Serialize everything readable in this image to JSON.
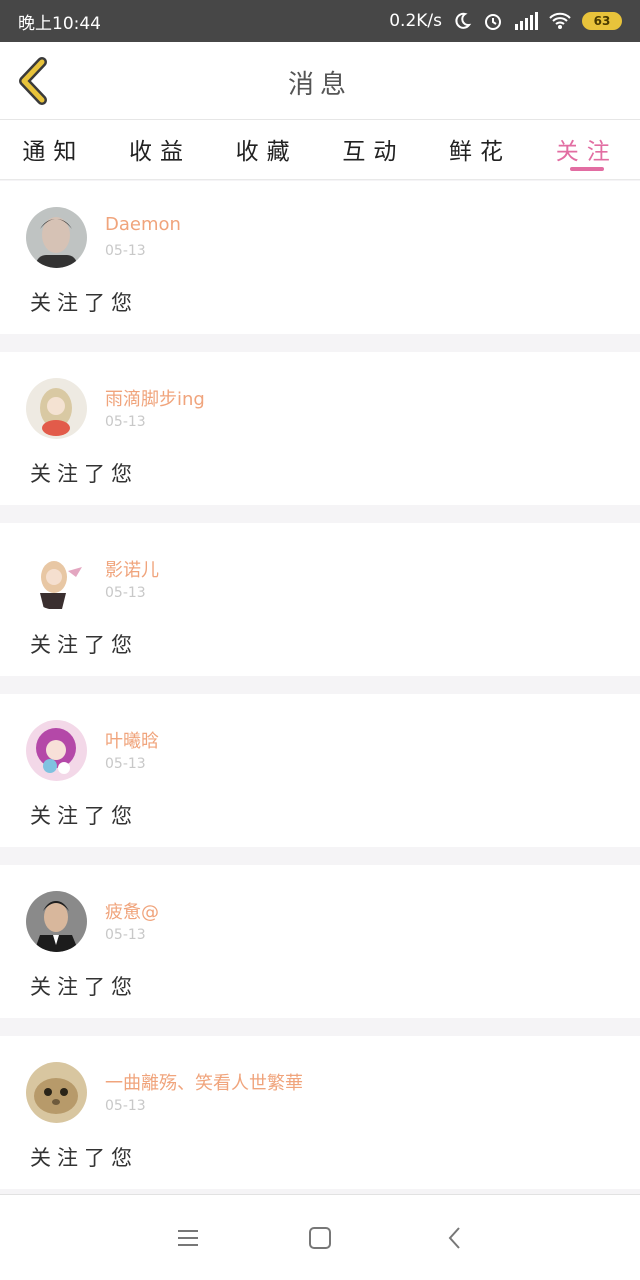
{
  "status_bar": {
    "time": "晚上10:44",
    "network_speed": "0.2K/s",
    "battery_level": "63",
    "icons": [
      "moon-icon",
      "alarm-icon",
      "signal-icon",
      "wifi-icon",
      "battery-icon"
    ]
  },
  "header": {
    "title": "消息",
    "back_icon": "chevron-left-icon"
  },
  "tabs": [
    {
      "label": "通知",
      "active": false
    },
    {
      "label": "收益",
      "active": false
    },
    {
      "label": "收藏",
      "active": false
    },
    {
      "label": "互动",
      "active": false
    },
    {
      "label": "鲜花",
      "active": false
    },
    {
      "label": "关注",
      "active": true
    }
  ],
  "messages": [
    {
      "name": "Daemon",
      "date": "05-13",
      "text": "关注了您",
      "avatar": "avatar-man-icon"
    },
    {
      "name": "雨滴脚步ing",
      "date": "05-13",
      "text": "关注了您",
      "avatar": "avatar-girl-icon"
    },
    {
      "name": "影诺儿",
      "date": "05-13",
      "text": "关注了您",
      "avatar": "avatar-anime-icon"
    },
    {
      "name": "叶曦晗",
      "date": "05-13",
      "text": "关注了您",
      "avatar": "avatar-anime-pink-icon"
    },
    {
      "name": "疲惫@",
      "date": "05-13",
      "text": "关注了您",
      "avatar": "avatar-man-suit-icon"
    },
    {
      "name": "一曲離殇、笑看人世繁華",
      "date": "05-13",
      "text": "关注了您",
      "avatar": "avatar-cat-icon"
    }
  ],
  "nav": {
    "menu_icon": "menu-icon",
    "home_icon": "home-square-icon",
    "back_icon": "back-chevron-icon"
  },
  "colors": {
    "accent": "#e26da2",
    "name": "#f0a47c",
    "date": "#c8c8c8",
    "back_arrow": "#e8c33b"
  }
}
